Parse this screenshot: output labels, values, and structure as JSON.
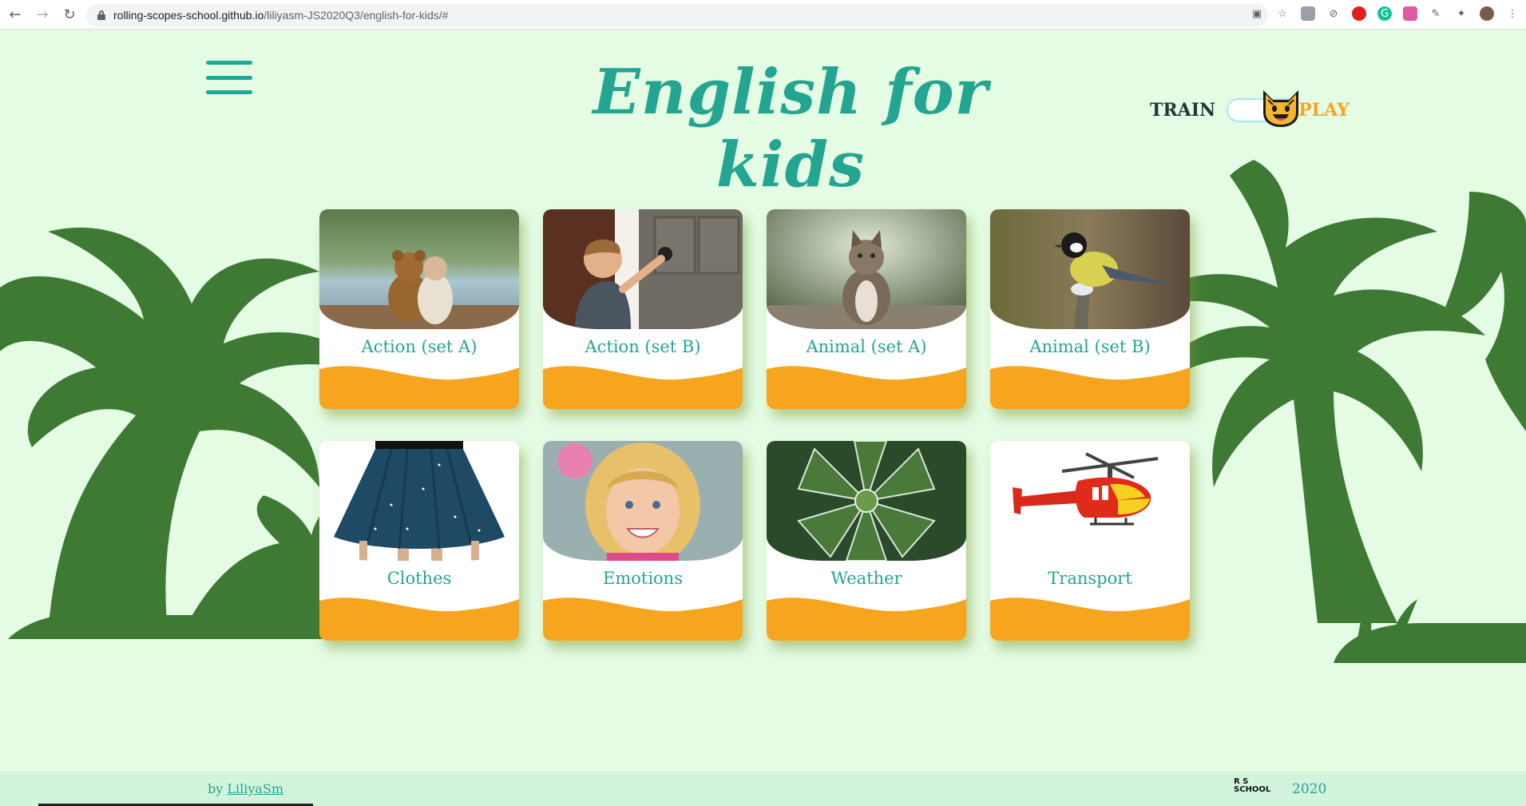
{
  "browser": {
    "url_host": "rolling-scopes-school.github.io",
    "url_path": "/liliyasm-JS2020Q3/english-for-kids/#"
  },
  "header": {
    "title": "English for kids",
    "train_label": "TRAIN",
    "play_label": "PLAY",
    "mode": "train"
  },
  "categories": [
    {
      "label": "Action (set A)",
      "image": "teddy-bear-hug"
    },
    {
      "label": "Action (set B)",
      "image": "boy-opening-door"
    },
    {
      "label": "Animal (set A)",
      "image": "cat"
    },
    {
      "label": "Animal (set B)",
      "image": "bird-tit"
    },
    {
      "label": "Clothes",
      "image": "blue-skirt"
    },
    {
      "label": "Emotions",
      "image": "smiling-girl"
    },
    {
      "label": "Weather",
      "image": "frosty-leaves"
    },
    {
      "label": "Transport",
      "image": "helicopter"
    }
  ],
  "footer": {
    "by_prefix": "by",
    "author": "LiliyaSm",
    "logo_line1": "R  S",
    "logo_line2": "SCHOOL",
    "year": "2020"
  },
  "colors": {
    "background": "#e4fbe4",
    "accent_teal": "#23a591",
    "accent_orange": "#f7a51f",
    "palm_green": "#3f7a35"
  }
}
